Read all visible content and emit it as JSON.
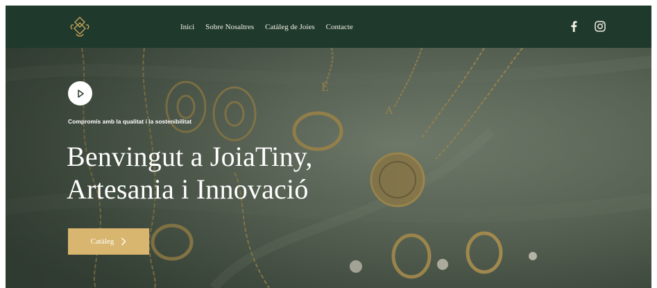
{
  "nav": {
    "links": [
      "Inici",
      "Sobre Nosaltres",
      "Catàleg de Joies",
      "Contacte"
    ],
    "social": [
      "facebook-icon",
      "instagram-icon"
    ]
  },
  "hero": {
    "tagline": "Compromís amb la qualitat i la sostenibilitat",
    "title_line1": "Benvingut a JoiaTiny,",
    "title_line2": "Artesania i Innovació",
    "cta_label": "Catàleg",
    "play_icon": "play-icon"
  },
  "colors": {
    "nav_bg": "#1f3a2c",
    "cta_bg": "#d9b66f",
    "text_light": "#ffffff",
    "gold": "#c7a45a"
  }
}
